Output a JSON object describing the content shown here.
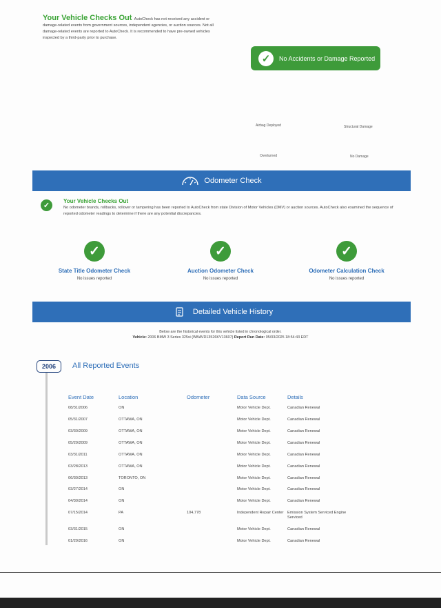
{
  "top": {
    "title": "Your Vehicle Checks Out",
    "text": "AutoCheck has not received any accident or damage-related events from government sources, independent agencies, or auction sources. Not all damage-related events are reported to AutoCheck. It is recommended to have pre-owned vehicles inspected by a third-party prior to purchase.",
    "badge": "No Accidents or Damage Reported",
    "labels": {
      "airbag": "Airbag Deployed",
      "structural": "Structural Damage",
      "overturned": "Overturned",
      "no_damage": "No Damage"
    }
  },
  "odometer": {
    "bar_title": "Odometer Check",
    "title": "Your Vehicle Checks Out",
    "text": "No odometer brands, rollbacks, rollover or tampering has been reported to AutoCheck from state Division of Motor Vehicles (DMV) or auction sources. AutoCheck also examined the sequence of reported odometer readings to determine if there are any potential discrepancies.",
    "checks": [
      {
        "title": "State Title Odometer Check",
        "status": "No issues reported"
      },
      {
        "title": "Auction Odometer Check",
        "status": "No issues reported"
      },
      {
        "title": "Odometer Calculation Check",
        "status": "No issues reported"
      }
    ]
  },
  "history": {
    "bar_title": "Detailed Vehicle History",
    "intro": "Below are the historical events for this vehicle listed in chronological order.",
    "vehicle_label": "Vehicle:",
    "vehicle_value": "2006 BMW 3 Series 325xi (WBAVD13526KV13607)",
    "run_date_label": "Report Run Date:",
    "run_date_value": "05/03/2025 18:54:43 EDT",
    "year": "2006",
    "section_title": "All Reported Events",
    "columns": [
      "Event Date",
      "Location",
      "Odometer",
      "Data Source",
      "Details"
    ],
    "rows": [
      {
        "date": "08/31/2006",
        "location": "ON",
        "odometer": "",
        "source": "Motor Vehicle Dept.",
        "details": "Canadian Renewal"
      },
      {
        "date": "05/31/2007",
        "location": "OTTAWA, ON",
        "odometer": "",
        "source": "Motor Vehicle Dept.",
        "details": "Canadian Renewal"
      },
      {
        "date": "03/30/2009",
        "location": "OTTAWA, ON",
        "odometer": "",
        "source": "Motor Vehicle Dept.",
        "details": "Canadian Renewal"
      },
      {
        "date": "05/29/2009",
        "location": "OTTAWA, ON",
        "odometer": "",
        "source": "Motor Vehicle Dept.",
        "details": "Canadian Renewal"
      },
      {
        "date": "03/31/2011",
        "location": "OTTAWA, ON",
        "odometer": "",
        "source": "Motor Vehicle Dept.",
        "details": "Canadian Renewal"
      },
      {
        "date": "03/28/2013",
        "location": "OTTAWA, ON",
        "odometer": "",
        "source": "Motor Vehicle Dept.",
        "details": "Canadian Renewal"
      },
      {
        "date": "06/30/2013",
        "location": "TORONTO, ON",
        "odometer": "",
        "source": "Motor Vehicle Dept.",
        "details": "Canadian Renewal"
      },
      {
        "date": "03/27/2014",
        "location": "ON",
        "odometer": "",
        "source": "Motor Vehicle Dept.",
        "details": "Canadian Renewal"
      },
      {
        "date": "04/30/2014",
        "location": "ON",
        "odometer": "",
        "source": "Motor Vehicle Dept.",
        "details": "Canadian Renewal"
      },
      {
        "date": "07/15/2014",
        "location": "PA",
        "odometer": "104,778",
        "source": "Independent Repair Center",
        "details": "Emission System Serviced Engine Serviced"
      },
      {
        "date": "03/31/2015",
        "location": "ON",
        "odometer": "",
        "source": "Motor Vehicle Dept.",
        "details": "Canadian Renewal"
      },
      {
        "date": "01/29/2016",
        "location": "ON",
        "odometer": "",
        "source": "Motor Vehicle Dept.",
        "details": "Canadian Renewal"
      }
    ]
  },
  "colors": {
    "green": "#3e9b3a",
    "blue": "#2f6fb8",
    "navy": "#1e3f7a"
  }
}
